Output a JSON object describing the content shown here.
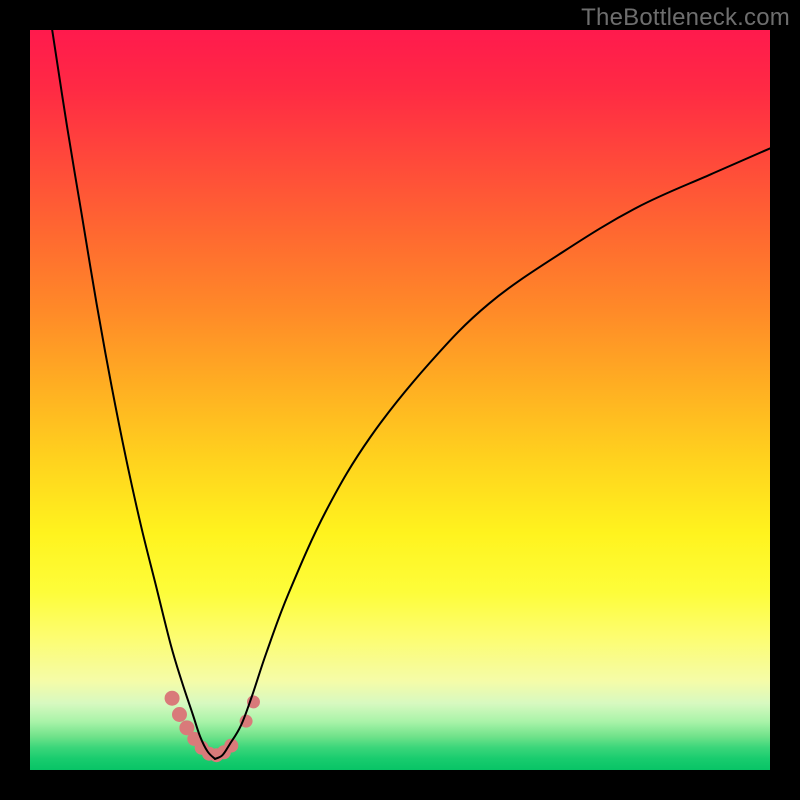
{
  "watermark": "TheBottleneck.com",
  "colors": {
    "frame": "#000000",
    "curve": "#000000",
    "marker": "#d97a7a",
    "gradient_top": "#ff1a4d",
    "gradient_bottom": "#08c466"
  },
  "chart_data": {
    "type": "line",
    "title": "",
    "xlabel": "",
    "ylabel": "",
    "xlim": [
      0,
      100
    ],
    "ylim": [
      0,
      100
    ],
    "grid": false,
    "legend": false,
    "note": "Axes are unlabeled; values are read as percentages of the plot area (0 = bottom-left, 100 = top-right). The two curves descend steeply from the top edge, meet near the bottom around x≈24, and the right curve rises gradually toward the right edge.",
    "series": [
      {
        "name": "left-curve",
        "x": [
          3,
          5,
          7,
          9,
          11,
          13,
          15,
          17,
          19,
          20.5,
          22,
          23,
          24,
          25
        ],
        "y": [
          100,
          87,
          75,
          63,
          52,
          42,
          33,
          25,
          17,
          12,
          7.5,
          4.5,
          2.5,
          1.5
        ]
      },
      {
        "name": "right-curve",
        "x": [
          25,
          26,
          27,
          28.5,
          30,
          32,
          35,
          40,
          46,
          54,
          62,
          72,
          82,
          92,
          100
        ],
        "y": [
          1.5,
          2,
          3.5,
          6,
          10,
          16,
          24,
          35,
          45,
          55,
          63,
          70,
          76,
          80.5,
          84
        ]
      }
    ],
    "markers": {
      "name": "highlight-points",
      "x": [
        19.2,
        20.2,
        21.2,
        22.2,
        23.2,
        24.2,
        25.2,
        26.2,
        27.2,
        29.2,
        30.2
      ],
      "y": [
        9.7,
        7.5,
        5.7,
        4.2,
        3.0,
        2.2,
        2.0,
        2.4,
        3.3,
        6.6,
        9.2
      ],
      "r": [
        7.5,
        7.5,
        7.5,
        7,
        7,
        7,
        7,
        7,
        7,
        6.5,
        6.5
      ]
    }
  }
}
